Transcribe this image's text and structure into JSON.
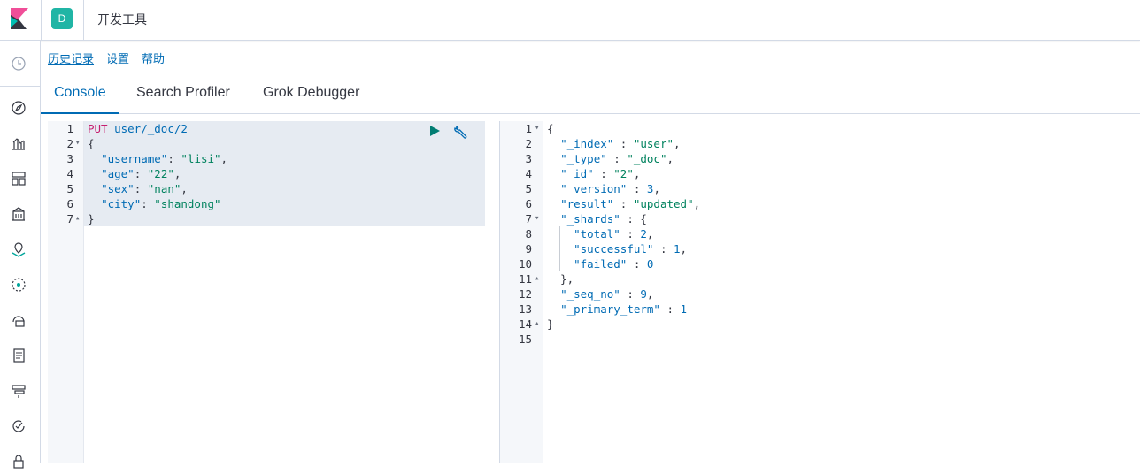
{
  "header": {
    "space_initial": "D",
    "app_title": "开发工具"
  },
  "top_links": {
    "history": "历史记录",
    "settings": "设置",
    "help": "帮助"
  },
  "tabs": [
    {
      "label": "Console",
      "active": true
    },
    {
      "label": "Search Profiler",
      "active": false
    },
    {
      "label": "Grok Debugger",
      "active": false
    }
  ],
  "left_nav_icons": [
    "clock-icon",
    "discover-icon",
    "visualize-icon",
    "dashboard-icon",
    "canvas-icon",
    "maps-icon",
    "ml-icon",
    "infrastructure-icon",
    "logs-icon",
    "apm-icon",
    "uptime-icon",
    "siem-icon"
  ],
  "request": {
    "method": "PUT",
    "path": "user/_doc/2",
    "lines": [
      {
        "num": "1",
        "fold": ""
      },
      {
        "num": "2",
        "fold": "▾",
        "text": "{"
      },
      {
        "num": "3",
        "fold": "",
        "key": "\"username\"",
        "val": "\"lisi\"",
        "tail": ","
      },
      {
        "num": "4",
        "fold": "",
        "key": "\"age\"",
        "val": "\"22\"",
        "tail": ","
      },
      {
        "num": "5",
        "fold": "",
        "key": "\"sex\"",
        "val": "\"nan\"",
        "tail": ","
      },
      {
        "num": "6",
        "fold": "",
        "key": "\"city\"",
        "val": "\"shandong\"",
        "tail": ""
      },
      {
        "num": "7",
        "fold": "▴",
        "text": "}"
      }
    ]
  },
  "response": {
    "lines": [
      {
        "num": "1",
        "fold": "▾"
      },
      {
        "num": "2",
        "fold": ""
      },
      {
        "num": "3",
        "fold": ""
      },
      {
        "num": "4",
        "fold": ""
      },
      {
        "num": "5",
        "fold": ""
      },
      {
        "num": "6",
        "fold": ""
      },
      {
        "num": "7",
        "fold": "▾"
      },
      {
        "num": "8",
        "fold": ""
      },
      {
        "num": "9",
        "fold": ""
      },
      {
        "num": "10",
        "fold": ""
      },
      {
        "num": "11",
        "fold": "▴"
      },
      {
        "num": "12",
        "fold": ""
      },
      {
        "num": "13",
        "fold": ""
      },
      {
        "num": "14",
        "fold": "▴"
      },
      {
        "num": "15",
        "fold": ""
      }
    ],
    "index_key": "\"_index\"",
    "index_val": "\"user\"",
    "type_key": "\"_type\"",
    "type_val": "\"_doc\"",
    "id_key": "\"_id\"",
    "id_val": "\"2\"",
    "version_key": "\"_version\"",
    "version_val": "3",
    "result_key": "\"result\"",
    "result_val": "\"updated\"",
    "shards_key": "\"_shards\"",
    "total_key": "\"total\"",
    "total_val": "2",
    "successful_key": "\"successful\"",
    "successful_val": "1",
    "failed_key": "\"failed\"",
    "failed_val": "0",
    "seq_key": "\"_seq_no\"",
    "seq_val": "9",
    "term_key": "\"_primary_term\"",
    "term_val": "1"
  },
  "colors": {
    "accent": "#006bb4",
    "space_avatar": "#20b5a5",
    "string": "#00825e",
    "method": "#c61e6f",
    "run": "#017d73"
  }
}
